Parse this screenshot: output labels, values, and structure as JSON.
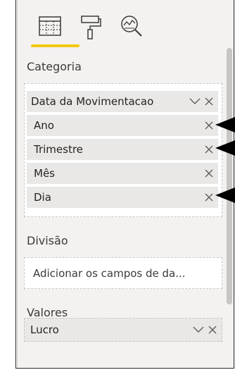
{
  "toolbar": {
    "tabs": [
      {
        "icon": "fields-table-icon",
        "active": true
      },
      {
        "icon": "paint-roller-icon",
        "active": false
      },
      {
        "icon": "analytics-magnifier-icon",
        "active": false
      }
    ]
  },
  "accent": "#f2c811",
  "categoria": {
    "label": "Categoria",
    "field": {
      "name": "Data da Movimentacao"
    },
    "hierarchy": [
      "Ano",
      "Trimestre",
      "Mês",
      "Dia"
    ]
  },
  "divisao": {
    "label": "Divisão",
    "placeholder": "Adicionar os campos de da..."
  },
  "valores": {
    "label": "Valores",
    "field": {
      "name": "Lucro"
    }
  }
}
